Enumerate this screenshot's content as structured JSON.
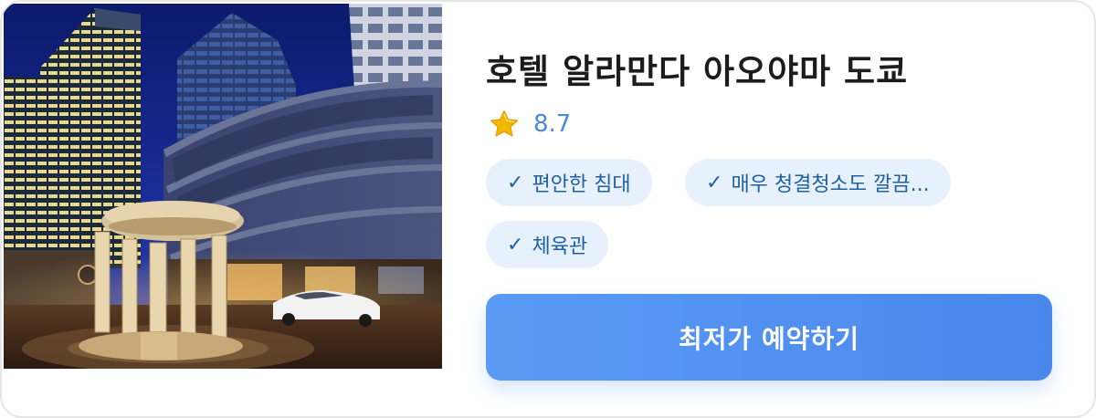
{
  "hotel": {
    "name": "호텔 알라만다 아오야마 도쿄",
    "rating": "8.7",
    "rating_icon": "star-icon",
    "photo_icon": "hotel-exterior-photo"
  },
  "amenities": [
    {
      "check": "✓",
      "label": "편안한 침대"
    },
    {
      "check": "✓",
      "label": "매우 청결청소도 깔끔..."
    },
    {
      "check": "✓",
      "label": "체육관"
    }
  ],
  "cta": {
    "label": "최저가 예약하기"
  },
  "colors": {
    "chip_background": "#e7f1fc",
    "chip_text": "#1f5fa8",
    "rating_text": "#4a8ad8",
    "cta_background": "#4a87ec",
    "star": "#f5b800"
  }
}
